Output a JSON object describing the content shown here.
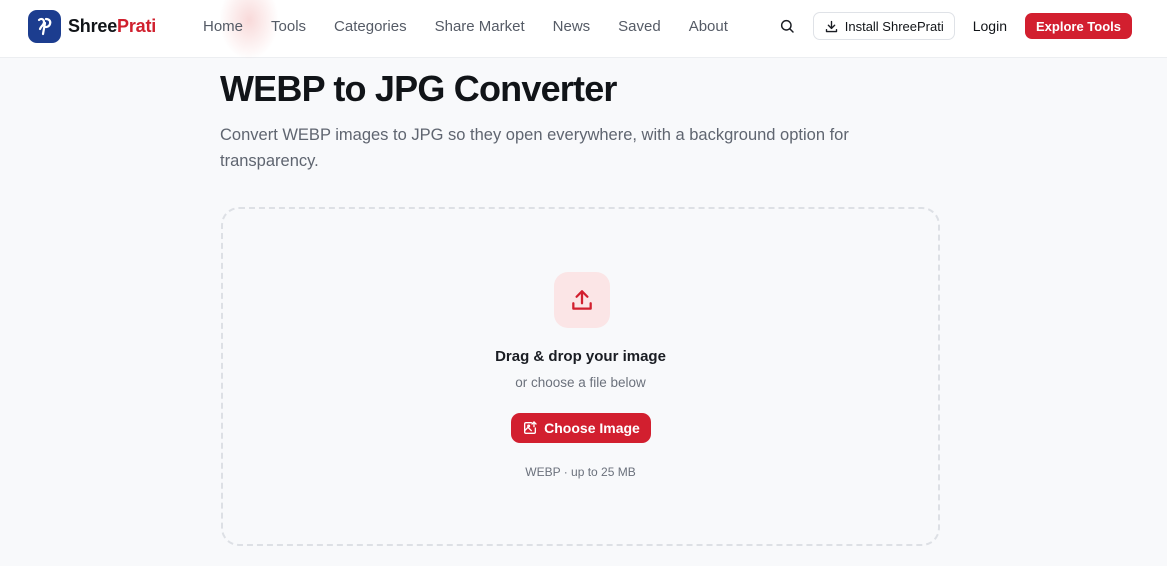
{
  "brand": {
    "name_part1": "Shree",
    "name_part2": "Prati",
    "primary_color": "#d21f2f",
    "logo_color": "#1c3d8f"
  },
  "nav": {
    "items": [
      {
        "label": "Home"
      },
      {
        "label": "Tools"
      },
      {
        "label": "Categories"
      },
      {
        "label": "Share Market"
      },
      {
        "label": "News"
      },
      {
        "label": "Saved"
      },
      {
        "label": "About"
      }
    ]
  },
  "header_actions": {
    "search_icon": "search-icon",
    "install_label": "Install ShreePrati",
    "install_icon": "download-icon",
    "login_label": "Login",
    "explore_label": "Explore Tools"
  },
  "main": {
    "title": "WEBP to JPG Converter",
    "description": "Convert WEBP images to JPG so they open everywhere, with a background option for transparency."
  },
  "dropzone": {
    "icon": "upload-icon",
    "title": "Drag & drop your image",
    "subtitle": "or choose a file below",
    "button_label": "Choose Image",
    "button_icon": "image-upload-icon",
    "meta": "WEBP · up to 25 MB"
  }
}
